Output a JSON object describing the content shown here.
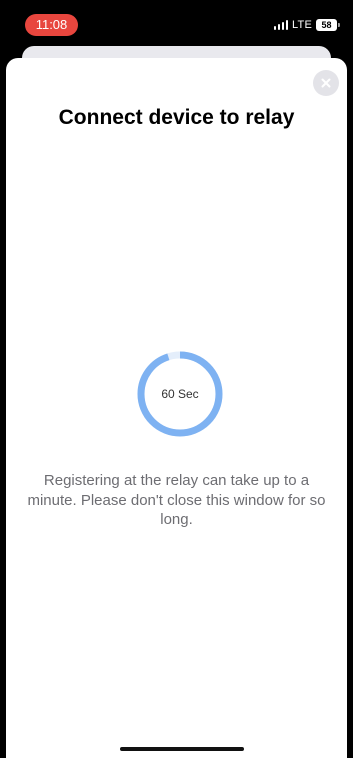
{
  "status_bar": {
    "time": "11:08",
    "network": "LTE",
    "battery": "58",
    "time_pill_color": "#e8463e"
  },
  "sheet": {
    "title": "Connect device to relay",
    "close_icon": "close-icon",
    "timer": {
      "label": "60 Sec",
      "progress": 0.95,
      "ring_color": "#7eb2f2",
      "track_color": "#e4eefb"
    },
    "info_text": "Registering at the relay can take up to a minute. Please don't close this window for so long."
  }
}
